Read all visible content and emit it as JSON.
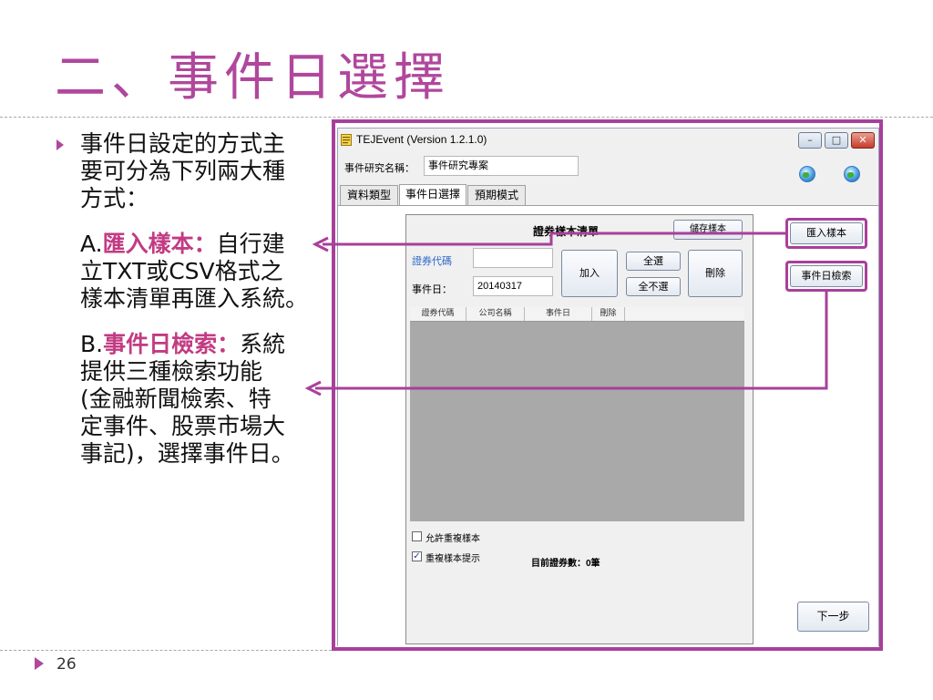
{
  "slide": {
    "title": "二、事件日選擇",
    "page_number": "26",
    "bullet_intro_1": "事件日設定的方式主",
    "bullet_intro_2": "要可分為下列兩大種",
    "bullet_intro_3": "方式：",
    "item_a_prefix": "A.",
    "item_a_term": "匯入樣本：",
    "item_a_line1_rest": "自行建",
    "item_a_line2": "立TXT或CSV格式之",
    "item_a_line3": "樣本清單再匯入系統。",
    "item_b_prefix": "B.",
    "item_b_term": "事件日檢索：",
    "item_b_line1_rest": "系統",
    "item_b_line2": "提供三種檢索功能",
    "item_b_line3": "(金融新聞檢索、特",
    "item_b_line4": "定事件、股票市場大",
    "item_b_line5": "事記)，選擇事件日。"
  },
  "app": {
    "window_title": "TEJEvent (Version 1.2.1.0)",
    "window_buttons": {
      "minimize": "–",
      "maximize": "□",
      "close": "✕"
    },
    "study_name_label": "事件研究名稱：",
    "study_name_value": "事件研究專案",
    "tabs": [
      {
        "label": "資料類型"
      },
      {
        "label": "事件日選擇"
      },
      {
        "label": "預期模式"
      }
    ],
    "panel": {
      "list_title": "證券樣本清單",
      "save_sample_button": "儲存樣本",
      "stock_code_label": "證券代碼",
      "stock_code_value": "",
      "event_date_label": "事件日：",
      "event_date_value": "20140317",
      "add_button": "加入",
      "select_all_button": "全選",
      "deselect_all_button": "全不選",
      "delete_button": "刪除",
      "grid_columns": [
        "證券代碼",
        "公司名稱",
        "事件日",
        "刪除"
      ],
      "allow_duplicate_label": "允許重複樣本",
      "allow_duplicate_checked": false,
      "duplicate_hint_label": "重複樣本提示",
      "duplicate_hint_checked": true,
      "count_text": "目前證券數：0筆"
    },
    "import_sample_button": "匯入樣本",
    "event_search_button": "事件日檢索",
    "next_button": "下一步"
  },
  "colors": {
    "accent": "#b0479c",
    "highlight_text": "#c23b83"
  }
}
